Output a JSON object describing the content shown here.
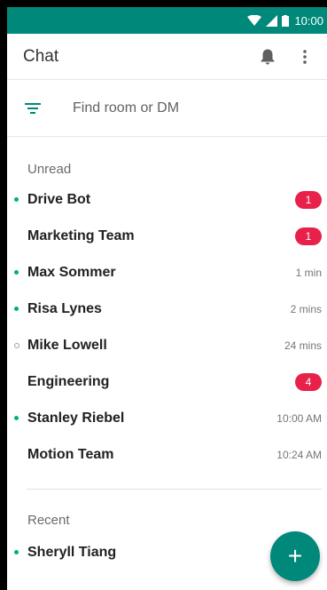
{
  "status_bar": {
    "time": "10:00",
    "icons": [
      "wifi-icon",
      "signal-icon",
      "battery-icon"
    ]
  },
  "app_bar": {
    "title": "Chat",
    "icons": [
      "bell-icon",
      "more-vert-icon"
    ]
  },
  "search": {
    "placeholder": "Find room or DM",
    "icon": "filter-icon"
  },
  "unread": {
    "header": "Unread",
    "rooms": [
      {
        "name": "Drive Bot",
        "presence": "online",
        "badge": "1",
        "time": ""
      },
      {
        "name": "Marketing Team",
        "presence": "none",
        "badge": "1",
        "time": ""
      },
      {
        "name": "Max Sommer",
        "presence": "online",
        "badge": "",
        "time": "1 min"
      },
      {
        "name": "Risa Lynes",
        "presence": "online",
        "badge": "",
        "time": "2 mins"
      },
      {
        "name": "Mike Lowell",
        "presence": "offline",
        "badge": "",
        "time": "24 mins"
      },
      {
        "name": "Engineering",
        "presence": "none",
        "badge": "4",
        "time": ""
      },
      {
        "name": "Stanley Riebel",
        "presence": "online",
        "badge": "",
        "time": "10:00 AM"
      },
      {
        "name": "Motion Team",
        "presence": "none",
        "badge": "",
        "time": "10:24 AM"
      }
    ]
  },
  "recent": {
    "header": "Recent",
    "rooms": [
      {
        "name": "Sheryll Tiang",
        "presence": "online",
        "badge": "",
        "time": ""
      }
    ]
  },
  "fab": {
    "label": "+",
    "icon": "plus-icon"
  },
  "colors": {
    "primary": "#00897b",
    "badge": "#e8214a",
    "online": "#00b36b"
  }
}
